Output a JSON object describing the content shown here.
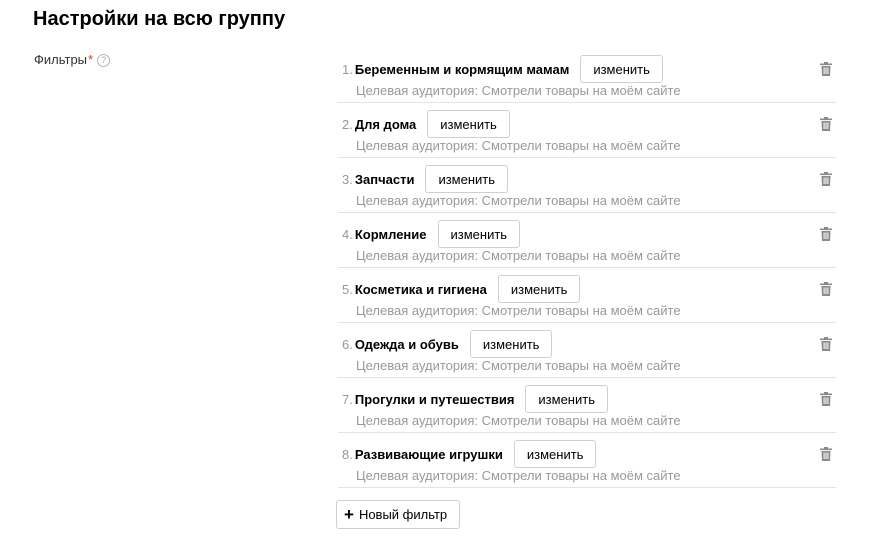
{
  "header": {
    "title": "Настройки на всю группу"
  },
  "filters_field": {
    "label": "Фильтры",
    "required_mark": "*",
    "help_icon": "question-circle-icon"
  },
  "filters": [
    {
      "num": "1.",
      "name": "Беременным и кормящим мамам",
      "edit_label": "изменить",
      "subtitle": "Целевая аудитория: Смотрели товары на моём сайте"
    },
    {
      "num": "2.",
      "name": "Для дома",
      "edit_label": "изменить",
      "subtitle": "Целевая аудитория: Смотрели товары на моём сайте"
    },
    {
      "num": "3.",
      "name": "Запчасти",
      "edit_label": "изменить",
      "subtitle": "Целевая аудитория: Смотрели товары на моём сайте"
    },
    {
      "num": "4.",
      "name": "Кормление",
      "edit_label": "изменить",
      "subtitle": "Целевая аудитория: Смотрели товары на моём сайте"
    },
    {
      "num": "5.",
      "name": "Косметика и гигиена",
      "edit_label": "изменить",
      "subtitle": "Целевая аудитория: Смотрели товары на моём сайте"
    },
    {
      "num": "6.",
      "name": "Одежда и обувь",
      "edit_label": "изменить",
      "subtitle": "Целевая аудитория: Смотрели товары на моём сайте"
    },
    {
      "num": "7.",
      "name": "Прогулки и путешествия",
      "edit_label": "изменить",
      "subtitle": "Целевая аудитория: Смотрели товары на моём сайте"
    },
    {
      "num": "8.",
      "name": "Развивающие игрушки",
      "edit_label": "изменить",
      "subtitle": "Целевая аудитория: Смотрели товары на моём сайте"
    }
  ],
  "new_filter_button": {
    "icon": "plus-icon",
    "label": "Новый фильтр"
  }
}
